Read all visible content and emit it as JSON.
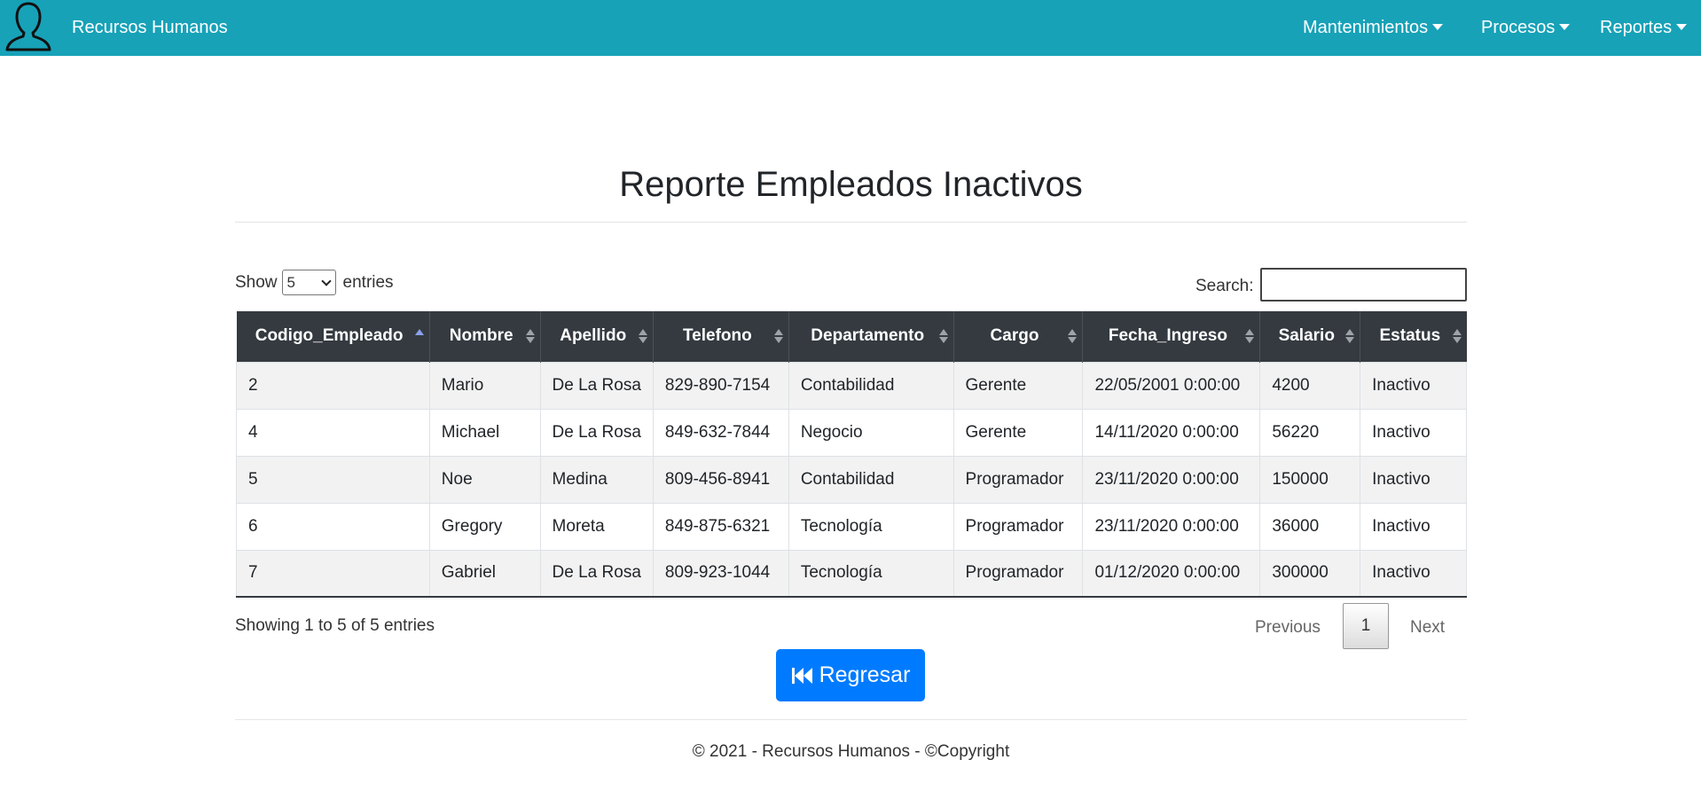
{
  "navbar": {
    "brand": "Recursos Humanos",
    "brand_icon": "user-silhouette-icon",
    "background": "#17a2b8",
    "menus": [
      {
        "label": "Mantenimientos"
      },
      {
        "label": "Procesos"
      },
      {
        "label": "Reportes"
      }
    ]
  },
  "page": {
    "title": "Reporte Empleados Inactivos"
  },
  "controls": {
    "show_label": "Show",
    "entries_value": "5",
    "entries_label": "entries",
    "search_label": "Search:",
    "search_value": ""
  },
  "table": {
    "columns": [
      "Codigo_Empleado",
      "Nombre",
      "Apellido",
      "Telefono",
      "Departamento",
      "Cargo",
      "Fecha_Ingreso",
      "Salario",
      "Estatus"
    ],
    "sorted_column": "Codigo_Empleado",
    "sort_direction": "asc",
    "rows": [
      [
        "2",
        "Mario",
        "De La Rosa",
        "829-890-7154",
        "Contabilidad",
        "Gerente",
        "22/05/2001 0:00:00",
        "4200",
        "Inactivo"
      ],
      [
        "4",
        "Michael",
        "De La Rosa",
        "849-632-7844",
        "Negocio",
        "Gerente",
        "14/11/2020 0:00:00",
        "56220",
        "Inactivo"
      ],
      [
        "5",
        "Noe",
        "Medina",
        "809-456-8941",
        "Contabilidad",
        "Programador",
        "23/11/2020 0:00:00",
        "150000",
        "Inactivo"
      ],
      [
        "6",
        "Gregory",
        "Moreta",
        "849-875-6321",
        "Tecnología",
        "Programador",
        "23/11/2020 0:00:00",
        "36000",
        "Inactivo"
      ],
      [
        "7",
        "Gabriel",
        "De La Rosa",
        "809-923-1044",
        "Tecnología",
        "Programador",
        "01/12/2020 0:00:00",
        "300000",
        "Inactivo"
      ]
    ]
  },
  "info": {
    "text": "Showing 1 to 5 of 5 entries"
  },
  "pagination": {
    "previous": "Previous",
    "current_page": "1",
    "next": "Next"
  },
  "actions": {
    "back_label": "Regresar",
    "back_icon": "fast-backward-icon",
    "back_color": "#007bff"
  },
  "footer": {
    "text": "© 2021 - Recursos Humanos - ©Copyright"
  }
}
